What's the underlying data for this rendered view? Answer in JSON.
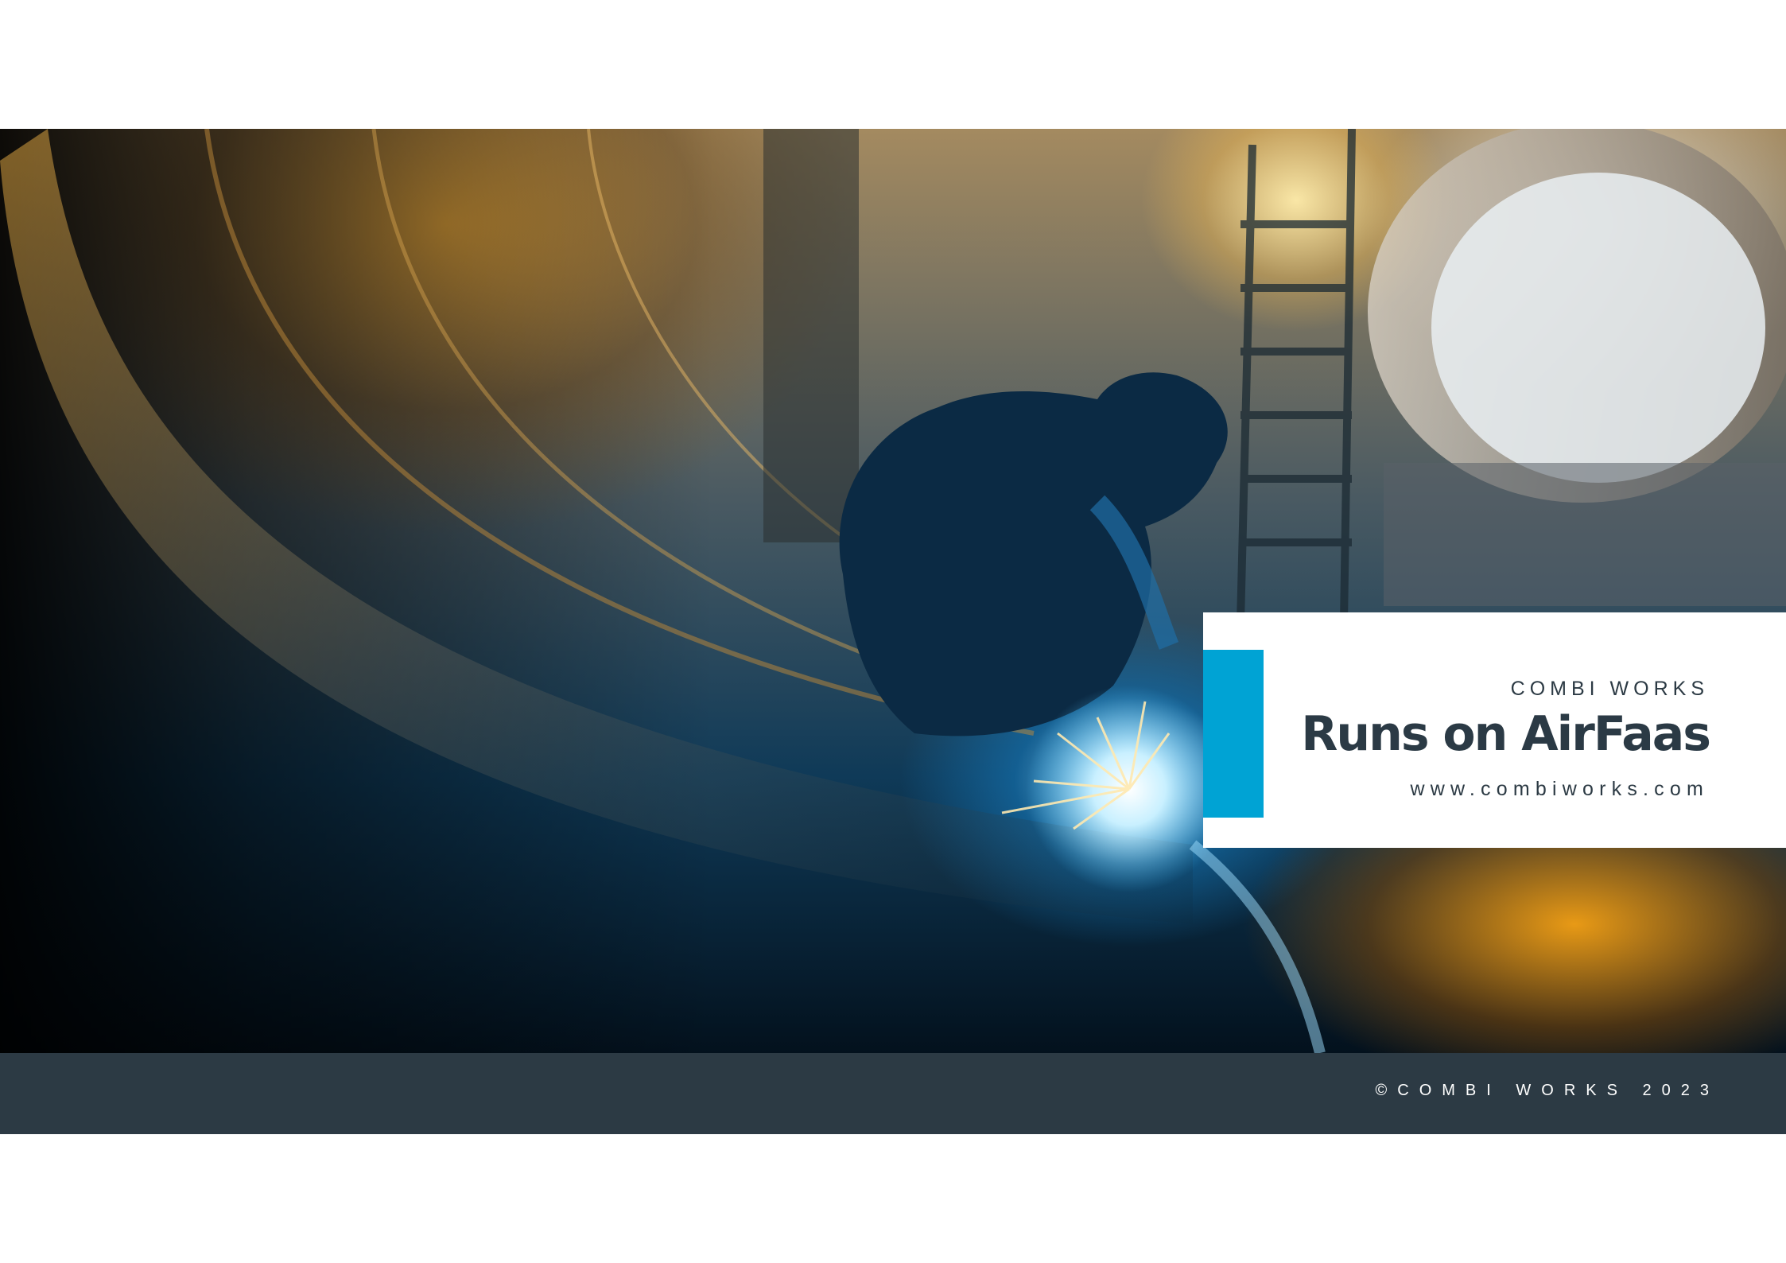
{
  "hero": {
    "image_alt": "Welder working inside a large steel pipe with sparks and warm industrial lighting"
  },
  "title_card": {
    "eyebrow": "COMBI WORKS",
    "headline": "Runs on AirFaas",
    "website": "www.combiworks.com"
  },
  "footer": {
    "copyright": "©COMBI WORKS 2023"
  },
  "colors": {
    "accent": "#00a3d4",
    "dark": "#2c3a44",
    "white": "#ffffff"
  }
}
